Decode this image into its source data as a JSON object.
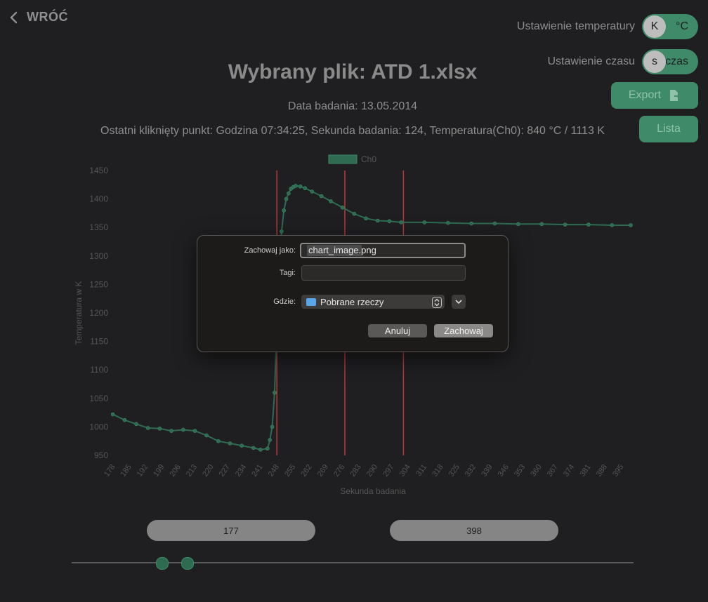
{
  "nav": {
    "back_label": "WRÓĆ"
  },
  "settings": {
    "temperature": {
      "label": "Ustawienie temperatury",
      "knob": "K",
      "option": "°C"
    },
    "time": {
      "label": "Ustawienie czasu",
      "knob": "s",
      "option": "czas"
    },
    "export_label": "Export",
    "list_label": "Lista"
  },
  "header": {
    "title": "Wybrany plik: ATD 1.xlsx",
    "date": "Data badania: 13.05.2014",
    "last_point": "Ostatni kliknięty punkt: Godzina 07:34:25, Sekunda badania: 124, Temperatura(Ch0): 840 °C / 1113 K"
  },
  "colors": {
    "accent": "#3f8a69",
    "series": "#2e6b52",
    "marker": "#b83a3a",
    "axis_text": "#555555"
  },
  "chart_data": {
    "type": "line",
    "legend": "Ch0",
    "legend_position": "top",
    "xlabel": "Sekunda badania",
    "ylabel": "Temperatura w K",
    "xlim": [
      178,
      398
    ],
    "ylim": [
      950,
      1450
    ],
    "yticks": [
      950,
      1000,
      1050,
      1100,
      1150,
      1200,
      1250,
      1300,
      1350,
      1400,
      1450
    ],
    "xticks": [
      178,
      185,
      192,
      199,
      206,
      213,
      220,
      227,
      234,
      241,
      248,
      255,
      262,
      269,
      276,
      283,
      290,
      297,
      304,
      311,
      318,
      325,
      332,
      339,
      346,
      353,
      360,
      367,
      374,
      381,
      388,
      395
    ],
    "markers_x": [
      247,
      276,
      301
    ],
    "series": [
      {
        "x": [
          177,
          182,
          187,
          192,
          197,
          202,
          207,
          212,
          217,
          222,
          227,
          232,
          237,
          240,
          243,
          244,
          245,
          246,
          247,
          248,
          249,
          250,
          251,
          252,
          253,
          254,
          255,
          257,
          259,
          262,
          266,
          270,
          275,
          280,
          285,
          290,
          295,
          300,
          310,
          320,
          330,
          340,
          350,
          360,
          370,
          380,
          390,
          398
        ],
        "y": [
          1022,
          1012,
          1005,
          998,
          997,
          993,
          995,
          993,
          985,
          975,
          971,
          967,
          963,
          960,
          962,
          977,
          1000,
          1060,
          1180,
          1280,
          1343,
          1380,
          1400,
          1410,
          1418,
          1421,
          1423,
          1422,
          1419,
          1413,
          1405,
          1396,
          1385,
          1374,
          1366,
          1362,
          1361,
          1359,
          1359,
          1358,
          1357,
          1357,
          1356,
          1356,
          1355,
          1355,
          1354,
          1354
        ]
      }
    ]
  },
  "range": {
    "start": "177",
    "end": "398",
    "slider": [
      177,
      189
    ],
    "slider_range": [
      135,
      398
    ]
  },
  "dialog": {
    "save_as_label": "Zachowaj jako:",
    "filename": "chart_image.png",
    "tags_label": "Tagi:",
    "where_label": "Gdzie:",
    "where_value": "Pobrane rzeczy",
    "cancel_label": "Anuluj",
    "save_label": "Zachowaj"
  }
}
